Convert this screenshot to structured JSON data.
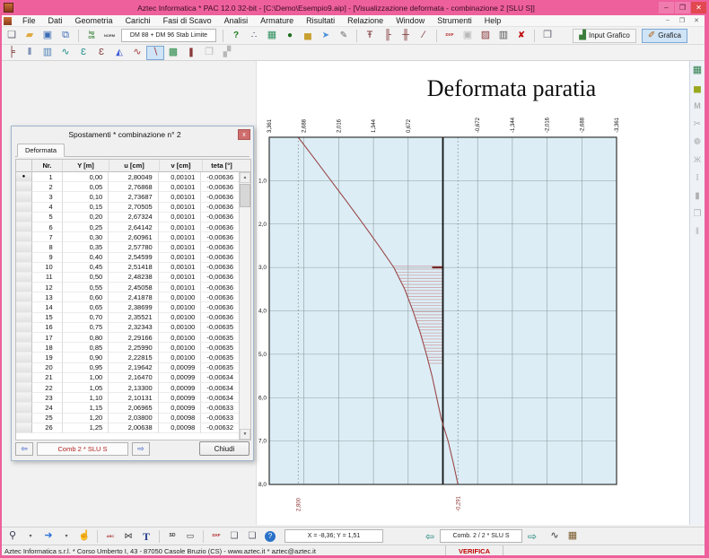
{
  "window": {
    "title": "Aztec Informatica * PAC 12.0 32-bit  - [C:\\Demo\\Esempio9.aip] - [Visualizzazione deformata  - combinazione 2  [SLU S]]",
    "controls": [
      {
        "name": "minimize-button",
        "glyph": "‒"
      },
      {
        "name": "maximize-button",
        "glyph": "❐"
      },
      {
        "name": "close-button",
        "glyph": "✕",
        "close": true
      }
    ],
    "mdi_controls": [
      {
        "name": "mdi-minimize-button",
        "glyph": "‒"
      },
      {
        "name": "mdi-restore-button",
        "glyph": "❐"
      },
      {
        "name": "mdi-close-button",
        "glyph": "✕"
      }
    ]
  },
  "menu": {
    "items": [
      "File",
      "Dati",
      "Geometria",
      "Carichi",
      "Fasi di Scavo",
      "Analisi",
      "Armature",
      "Risultati",
      "Relazione",
      "Window",
      "Strumenti",
      "Help"
    ]
  },
  "toolbar_top": {
    "pre_icons": [
      {
        "name": "new-file-icon",
        "glyph": "❏",
        "color": "#667",
        "size": 11
      },
      {
        "name": "open-folder-icon",
        "glyph": "▰",
        "color": "#e0a83c",
        "size": 11
      },
      {
        "name": "save-icon",
        "glyph": "▣",
        "color": "#3d6db5",
        "size": 11
      },
      {
        "name": "save-all-icon",
        "glyph": "⧉",
        "color": "#3d6db5",
        "size": 11
      },
      {
        "sep": true
      },
      {
        "name": "units-icon",
        "text": "kg\ncm",
        "color": "#2e7d32",
        "size": 5,
        "bold": true
      },
      {
        "name": "normative-icon",
        "text": "NORM",
        "color": "#444",
        "size": 4,
        "bold": true
      }
    ],
    "norm_text": "DM 88 + DM 96 Stab Limite",
    "post_icons": [
      {
        "sep": true
      },
      {
        "name": "check-data-icon",
        "glyph": "?",
        "color": "#1b7e1b",
        "size": 10,
        "bold": true
      },
      {
        "name": "analysis-options-icon",
        "glyph": "∴",
        "color": "#335",
        "size": 10
      },
      {
        "name": "grid-table-icon",
        "glyph": "▦",
        "color": "#2f8f5f",
        "size": 11
      },
      {
        "name": "materials-icon",
        "glyph": "●",
        "color": "#1e6b1e",
        "size": 10
      },
      {
        "name": "soil-layers-icon",
        "glyph": "▅",
        "color": "#c8a030",
        "size": 10
      },
      {
        "name": "section-plane-icon",
        "glyph": "➤",
        "color": "#4a90d9",
        "size": 10
      },
      {
        "name": "edit-drawing-icon",
        "glyph": "✎",
        "color": "#666",
        "size": 10
      },
      {
        "sep": true
      },
      {
        "name": "wall-load-icon",
        "glyph": "Ŧ",
        "color": "#7a3030",
        "size": 11
      },
      {
        "name": "wall-anchor-left-icon",
        "glyph": "╟",
        "color": "#7a3030",
        "size": 11
      },
      {
        "name": "wall-anchor-both-icon",
        "glyph": "╫",
        "color": "#7a3030",
        "size": 11
      },
      {
        "name": "wall-inclined-icon",
        "glyph": "∕",
        "color": "#7a3030",
        "size": 11
      },
      {
        "sep": true
      },
      {
        "name": "dxf-export-icon",
        "text": "DXF",
        "color": "#b22222",
        "size": 4.5,
        "bold": true
      },
      {
        "name": "save-results-icon",
        "glyph": "▣",
        "disabled": true,
        "size": 11
      },
      {
        "name": "rebar-design-icon",
        "glyph": "▨",
        "color": "#8a3a3a",
        "size": 11
      },
      {
        "name": "rebar-edit-icon",
        "glyph": "▥",
        "color": "#555",
        "size": 11
      },
      {
        "name": "rebar-delete-icon",
        "glyph": "✘",
        "color": "#c00000",
        "size": 10
      },
      {
        "sep": true
      },
      {
        "name": "report-icon",
        "glyph": "❒",
        "color": "#667",
        "size": 11
      }
    ],
    "input_grafico_label": "Input Grafico",
    "grafica_label": "Grafica"
  },
  "toolbar_view": {
    "icons": [
      {
        "name": "wall-profile-icon",
        "glyph": "╞",
        "color": "#7a3030",
        "size": 11
      },
      {
        "name": "piles-icon",
        "glyph": "‖",
        "color": "#33518f",
        "size": 11
      },
      {
        "name": "wall-3d-icon",
        "glyph": "▥",
        "color": "#4a7fb5",
        "size": 11
      },
      {
        "name": "moment-diagrams-icon",
        "glyph": "∿",
        "color": "#1a8a8a",
        "size": 11
      },
      {
        "name": "pressure-left-icon",
        "glyph": "Ɛ",
        "color": "#1a8a8a",
        "size": 10
      },
      {
        "name": "pressure-right-icon",
        "glyph": "Ɛ",
        "color": "#7a3030",
        "size": 10
      },
      {
        "name": "pressure-diagram-icon",
        "glyph": "◭",
        "color": "#3b5bd6",
        "size": 10
      },
      {
        "name": "displacement-plot-icon",
        "glyph": "∿",
        "color": "#a33a3a",
        "size": 11
      },
      {
        "name": "deformed-shape-icon",
        "glyph": "∖",
        "color": "#a33a3a",
        "size": 11,
        "selected": true
      },
      {
        "name": "color-map-icon",
        "glyph": "▩",
        "color": "#2a8a4a",
        "size": 11
      },
      {
        "name": "wall-displacement-icon",
        "glyph": "❚",
        "color": "#8a3a3a",
        "size": 10
      },
      {
        "name": "report-preview-icon",
        "glyph": "❐",
        "disabled": true,
        "size": 11
      },
      {
        "name": "legend-icon",
        "glyph": "▞",
        "disabled": true,
        "size": 11
      }
    ]
  },
  "sidebar": {
    "icons": [
      {
        "name": "results-grid-icon",
        "glyph": "▦",
        "color": "#2f7f4f",
        "size": 11
      },
      {
        "name": "chart-icon",
        "glyph": "▅",
        "color": "#9aa820",
        "size": 10
      },
      {
        "name": "moment-table-icon",
        "glyph": "M",
        "disabled": true,
        "size": 9,
        "bold": true
      },
      {
        "name": "cut-section-icon",
        "glyph": "✂",
        "disabled": true,
        "size": 10
      },
      {
        "name": "options-flower-icon",
        "glyph": "❁",
        "disabled": true,
        "size": 10
      },
      {
        "name": "rebar-cut-icon",
        "glyph": "Ж",
        "disabled": true,
        "size": 9
      },
      {
        "name": "section-I-icon",
        "glyph": "I",
        "disabled": true,
        "size": 10,
        "serif": true
      },
      {
        "name": "filled-block-icon",
        "glyph": "▮",
        "disabled": true,
        "size": 10
      },
      {
        "name": "print-area-icon",
        "glyph": "❒",
        "disabled": true,
        "size": 10
      },
      {
        "name": "double-bar-icon",
        "glyph": "‖",
        "disabled": true,
        "size": 10
      }
    ]
  },
  "dialog": {
    "title": "Spostamenti * combinazione n° 2",
    "tab": "Deformata",
    "close_glyph": "x",
    "table": {
      "headers": [
        "Nr.",
        "Y [m]",
        "u [cm]",
        "v [cm]",
        "teta [°]"
      ],
      "rows": [
        [
          "1",
          "0,00",
          "2,80049",
          "0,00101",
          "-0,00636"
        ],
        [
          "2",
          "0,05",
          "2,76868",
          "0,00101",
          "-0,00636"
        ],
        [
          "3",
          "0,10",
          "2,73687",
          "0,00101",
          "-0,00636"
        ],
        [
          "4",
          "0,15",
          "2,70505",
          "0,00101",
          "-0,00636"
        ],
        [
          "5",
          "0,20",
          "2,67324",
          "0,00101",
          "-0,00636"
        ],
        [
          "6",
          "0,25",
          "2,64142",
          "0,00101",
          "-0,00636"
        ],
        [
          "7",
          "0,30",
          "2,60961",
          "0,00101",
          "-0,00636"
        ],
        [
          "8",
          "0,35",
          "2,57780",
          "0,00101",
          "-0,00636"
        ],
        [
          "9",
          "0,40",
          "2,54599",
          "0,00101",
          "-0,00636"
        ],
        [
          "10",
          "0,45",
          "2,51418",
          "0,00101",
          "-0,00636"
        ],
        [
          "11",
          "0,50",
          "2,48238",
          "0,00101",
          "-0,00636"
        ],
        [
          "12",
          "0,55",
          "2,45058",
          "0,00101",
          "-0,00636"
        ],
        [
          "13",
          "0,60",
          "2,41878",
          "0,00100",
          "-0,00636"
        ],
        [
          "14",
          "0,65",
          "2,38699",
          "0,00100",
          "-0,00636"
        ],
        [
          "15",
          "0,70",
          "2,35521",
          "0,00100",
          "-0,00636"
        ],
        [
          "16",
          "0,75",
          "2,32343",
          "0,00100",
          "-0,00635"
        ],
        [
          "17",
          "0,80",
          "2,29166",
          "0,00100",
          "-0,00635"
        ],
        [
          "18",
          "0,85",
          "2,25990",
          "0,00100",
          "-0,00635"
        ],
        [
          "19",
          "0,90",
          "2,22815",
          "0,00100",
          "-0,00635"
        ],
        [
          "20",
          "0,95",
          "2,19642",
          "0,00099",
          "-0,00635"
        ],
        [
          "21",
          "1,00",
          "2,16470",
          "0,00099",
          "-0,00634"
        ],
        [
          "22",
          "1,05",
          "2,13300",
          "0,00099",
          "-0,00634"
        ],
        [
          "23",
          "1,10",
          "2,10131",
          "0,00099",
          "-0,00634"
        ],
        [
          "24",
          "1,15",
          "2,06965",
          "0,00099",
          "-0,00633"
        ],
        [
          "25",
          "1,20",
          "2,03800",
          "0,00098",
          "-0,00633"
        ],
        [
          "26",
          "1,25",
          "2,00638",
          "0,00098",
          "-0,00632"
        ]
      ]
    },
    "nav_prev_glyph": "⇦",
    "nav_next_glyph": "⇨",
    "nav_label": "Comb 2 * SLU S",
    "close_label": "Chiudi"
  },
  "chart_data": {
    "type": "line",
    "title": "Deformata paratia",
    "x_tick_labels": [
      "3,361",
      "2,688",
      "2,016",
      "1,344",
      "0,672",
      "-0,672",
      "-1,344",
      "-2,016",
      "-2,688",
      "-3,361"
    ],
    "x_ticks_cm": [
      3.361,
      2.688,
      2.016,
      1.344,
      0.672,
      -0.672,
      -1.344,
      -2.016,
      -2.688,
      -3.361
    ],
    "x_range_cm": [
      3.361,
      -3.361
    ],
    "y_tick_labels": [
      "1,0",
      "2,0",
      "3,0",
      "4,0",
      "5,0",
      "6,0",
      "7,0",
      "8,0"
    ],
    "y_ticks_m": [
      1,
      2,
      3,
      4,
      5,
      6,
      7,
      8
    ],
    "y_range_m": [
      0,
      8
    ],
    "wall_u_cm": 0,
    "anchor_depth_m": 3.0,
    "hatch_y_from_m": 2.97,
    "hatch_y_to_m": 5.25,
    "markers": [
      {
        "u_cm": 2.8,
        "label": "2,800"
      },
      {
        "u_cm": -0.291,
        "label": "-0,291"
      }
    ],
    "curve_points_y_u": [
      [
        0,
        2.8
      ],
      [
        0.5,
        2.48
      ],
      [
        1,
        2.165
      ],
      [
        1.5,
        1.85
      ],
      [
        2,
        1.54
      ],
      [
        2.5,
        1.24
      ],
      [
        3,
        0.95
      ],
      [
        3.5,
        0.74
      ],
      [
        4,
        0.58
      ],
      [
        4.5,
        0.44
      ],
      [
        5,
        0.32
      ],
      [
        5.5,
        0.21
      ],
      [
        6,
        0.12
      ],
      [
        6.5,
        0.03
      ],
      [
        7,
        -0.1
      ],
      [
        7.5,
        -0.2
      ],
      [
        8,
        -0.291
      ]
    ],
    "grid": true,
    "legend": "none",
    "colors": {
      "plot_bg": "#dcedf6",
      "grid": "#8e9e9e",
      "frame": "#333333",
      "wall": "#111111",
      "curve": "#9a4848",
      "hatch": "#cc9999",
      "anchor": "#6b1f1f",
      "marker_line": "#888888",
      "marker_text": "#8b3030"
    }
  },
  "bottom_toolbar": {
    "icons": [
      {
        "name": "zoom-icon",
        "glyph": "⚲",
        "color": "#335",
        "size": 11
      },
      {
        "name": "zoom-dropdown-icon",
        "glyph": "▾",
        "color": "#555",
        "size": 6
      },
      {
        "name": "pan-arrow-icon",
        "glyph": "➜",
        "color": "#2a6fd6",
        "size": 11
      },
      {
        "name": "pan-dropdown-icon",
        "glyph": "▾",
        "color": "#555",
        "size": 6
      },
      {
        "name": "hand-icon",
        "glyph": "☝",
        "color": "#c8a268",
        "size": 11
      },
      {
        "sep": true
      },
      {
        "name": "char-style-icon",
        "text": "ABC",
        "color": "#a33",
        "size": 4,
        "bold": true
      },
      {
        "name": "pointer-icon",
        "glyph": "⋈",
        "color": "#333",
        "size": 9
      },
      {
        "name": "text-tool-icon",
        "glyph": "T",
        "color": "#223a8c",
        "size": 12,
        "bold": true,
        "serif": true
      },
      {
        "sep": true
      },
      {
        "name": "dimension-sd-icon",
        "text": "SD",
        "color": "#333",
        "size": 5,
        "bold": true
      },
      {
        "name": "dimension-style-icon",
        "glyph": "▭",
        "color": "#333",
        "size": 9
      },
      {
        "sep": true
      },
      {
        "name": "dxf-icon",
        "text": "DXF",
        "color": "#b22222",
        "size": 4.5,
        "bold": true
      },
      {
        "name": "print-setup-icon",
        "glyph": "❑",
        "color": "#556",
        "size": 10
      },
      {
        "name": "print-preview-icon",
        "glyph": "❏",
        "color": "#556",
        "size": 10
      },
      {
        "name": "help-icon",
        "glyph": "?",
        "color": "#ffffff",
        "size": 8,
        "badge": true
      }
    ],
    "coords": "X = -8,36;  Y = 1,51",
    "nav_prev_glyph": "⇦",
    "nav_next_glyph": "⇨",
    "combo": "Comb. 2 / 2 * SLU S",
    "post_icons": [
      {
        "name": "diagram-curve-icon",
        "glyph": "∿",
        "color": "#333",
        "size": 11
      },
      {
        "name": "values-table-icon",
        "glyph": "▦",
        "color": "#7a5a2a",
        "size": 11
      }
    ]
  },
  "status_bar": {
    "left": "Aztec Informatica s.r.l. * Corso Umberto I, 43 - 87050 Casole Bruzio (CS)  -  www.aztec.it *  aztec@aztec.it",
    "right": "VERIFICA"
  },
  "frame_color": "#ee609c"
}
